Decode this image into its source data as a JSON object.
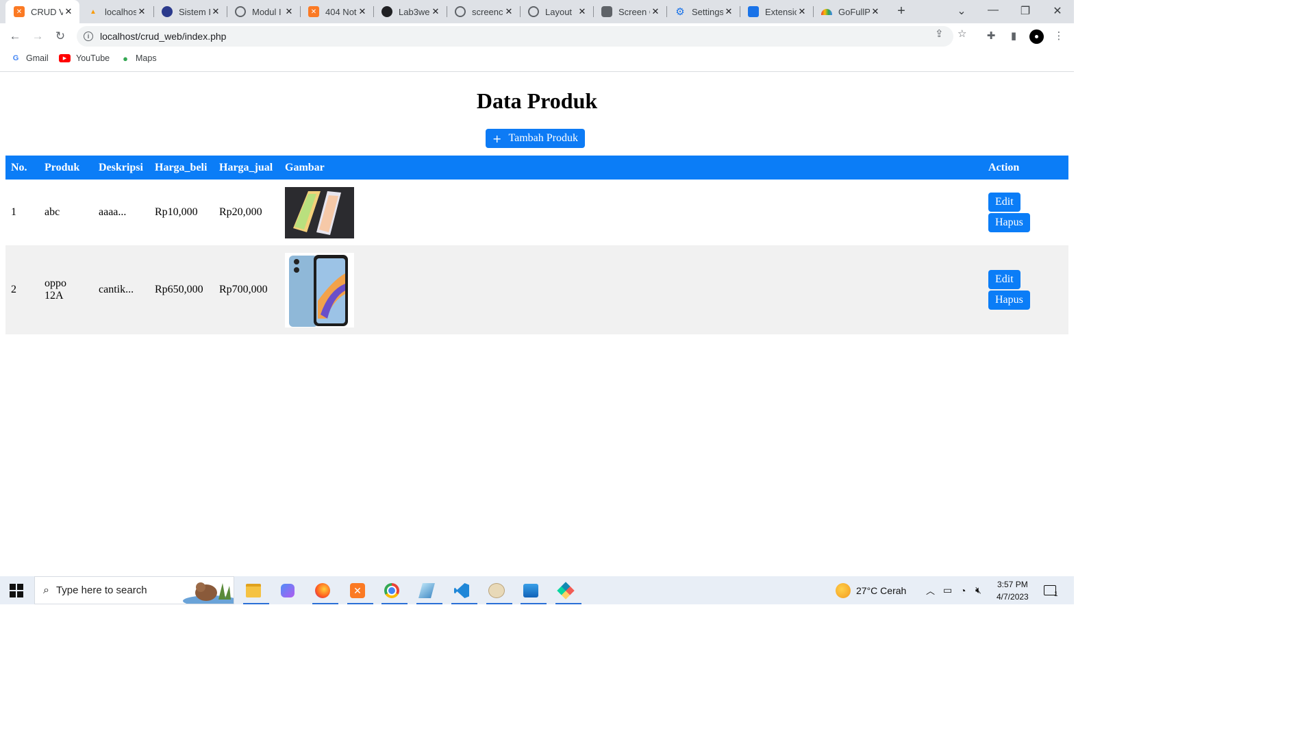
{
  "browser": {
    "tabs": [
      {
        "title": "CRUD V",
        "active": true,
        "favicon": "xampp-icon",
        "color": "#fb7a24"
      },
      {
        "title": "localhos",
        "active": false,
        "favicon": "phpmyadmin-icon",
        "color": "#f89c0e"
      },
      {
        "title": "Sistem I",
        "active": false,
        "favicon": "university-icon",
        "color": "#2b3a8c"
      },
      {
        "title": "Modul I",
        "active": false,
        "favicon": "globe-icon",
        "color": "#5f6368"
      },
      {
        "title": "404 Not",
        "active": false,
        "favicon": "xampp-icon",
        "color": "#fb7a24"
      },
      {
        "title": "Lab3we",
        "active": false,
        "favicon": "github-icon",
        "color": "#202124"
      },
      {
        "title": "screenc",
        "active": false,
        "favicon": "globe-icon",
        "color": "#5f6368"
      },
      {
        "title": "Layout",
        "active": false,
        "favicon": "globe-icon",
        "color": "#5f6368"
      },
      {
        "title": "Screen C",
        "active": false,
        "favicon": "camera-icon",
        "color": "#5f6368"
      },
      {
        "title": "Settings",
        "active": false,
        "favicon": "gear-icon",
        "color": "#1a73e8"
      },
      {
        "title": "Extensio",
        "active": false,
        "favicon": "puzzle-icon",
        "color": "#1a73e8"
      },
      {
        "title": "GoFullP",
        "active": false,
        "favicon": "rainbow-icon",
        "color": "#ea4335"
      }
    ],
    "url": "localhost/crud_web/index.php",
    "bookmarks": [
      {
        "label": "Gmail",
        "icon": "google-icon"
      },
      {
        "label": "YouTube",
        "icon": "youtube-icon"
      },
      {
        "label": "Maps",
        "icon": "maps-icon"
      }
    ]
  },
  "page": {
    "title": "Data Produk",
    "add_button": "Tambah Produk",
    "add_icon": "+",
    "columns": [
      "No.",
      "Produk",
      "Deskripsi",
      "Harga_beli",
      "Harga_jual",
      "Gambar",
      "Action"
    ],
    "rows": [
      {
        "no": "1",
        "produk": "abc",
        "deskripsi": "aaaa...",
        "harga_beli": "Rp10,000",
        "harga_jual": "Rp20,000",
        "edit": "Edit",
        "hapus": "Hapus"
      },
      {
        "no": "2",
        "produk": "oppo 12A",
        "deskripsi": "cantik...",
        "harga_beli": "Rp650,000",
        "harga_jual": "Rp700,000",
        "edit": "Edit",
        "hapus": "Hapus"
      }
    ],
    "accent_color": "#0b7df7"
  },
  "taskbar": {
    "search_placeholder": "Type here to search",
    "weather": "27°C  Cerah",
    "time": "3:57 PM",
    "date": "4/7/2023",
    "notification_count": "1"
  }
}
